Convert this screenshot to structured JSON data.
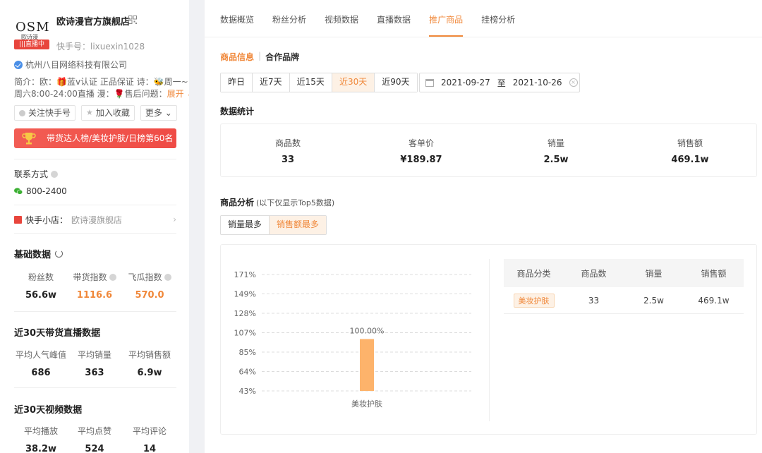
{
  "shop": {
    "logo_text": "OSM",
    "logo_sub": "欧诗漫",
    "live_badge": "|||直播中",
    "title": "欧诗漫官方旗舰店",
    "kuaishou_id": "快手号：lixuexin1028",
    "company": "杭州八目网络科技有限公司",
    "intro_line1": "简介：欧：🎁蓝v认证 正品保证 诗：🐝周一~",
    "intro_line2": "周六8:00-24:00直播 漫：🌹售后问题：",
    "expand": "展开 ⌄",
    "btn_follow": "关注快手号",
    "btn_collect": "加入收藏",
    "btn_more": "更多 ⌄",
    "rank_banner": "带货达人榜/美妆护肤/日榜第60名"
  },
  "contact": {
    "label": "联系方式",
    "phone": "800-2400"
  },
  "store": {
    "label": "快手小店：",
    "name": "欧诗漫旗舰店"
  },
  "basic": {
    "title": "基础数据",
    "items": [
      {
        "label": "粉丝数",
        "value": "56.6w"
      },
      {
        "label": "带货指数",
        "value": "1116.6"
      },
      {
        "label": "飞瓜指数",
        "value": "570.0"
      }
    ]
  },
  "live30": {
    "title": "近30天带货直播数据",
    "items": [
      {
        "label": "平均人气峰值",
        "value": "686"
      },
      {
        "label": "平均销量",
        "value": "363"
      },
      {
        "label": "平均销售额",
        "value": "6.9w"
      }
    ]
  },
  "video30": {
    "title": "近30天视频数据",
    "items": [
      {
        "label": "平均播放",
        "value": "38.2w"
      },
      {
        "label": "平均点赞",
        "value": "524"
      },
      {
        "label": "平均评论",
        "value": "14"
      }
    ]
  },
  "tabs": [
    "数据概览",
    "粉丝分析",
    "视频数据",
    "直播数据",
    "推广商品",
    "挂榜分析"
  ],
  "subtabs": [
    "商品信息",
    "合作品牌"
  ],
  "ranges": [
    "昨日",
    "近7天",
    "近15天",
    "近30天",
    "近90天"
  ],
  "date": {
    "start": "2021-09-27",
    "sep": "至",
    "end": "2021-10-26"
  },
  "stats": {
    "title": "数据统计",
    "items": [
      {
        "label": "商品数",
        "value": "33"
      },
      {
        "label": "客单价",
        "value": "¥189.87"
      },
      {
        "label": "销量",
        "value": "2.5w"
      },
      {
        "label": "销售额",
        "value": "469.1w"
      }
    ]
  },
  "analysis": {
    "title": "商品分析",
    "note": "(以下仅显示Top5数据)",
    "buttons": [
      "销量最多",
      "销售额最多"
    ],
    "table_headers": [
      "商品分类",
      "商品数",
      "销量",
      "销售额"
    ],
    "rows": [
      {
        "category": "美妆护肤",
        "count": "33",
        "sales": "2.5w",
        "revenue": "469.1w"
      }
    ]
  },
  "chart_data": {
    "type": "bar",
    "y_ticks": [
      "171%",
      "149%",
      "128%",
      "107%",
      "85%",
      "64%",
      "43%"
    ],
    "ylim": [
      43,
      171
    ],
    "categories": [
      "美妆护肤"
    ],
    "values": [
      100
    ],
    "data_labels": [
      "100.00%"
    ],
    "bar_color": "#fdb36b",
    "grid": true
  },
  "colors": {
    "accent": "#f0883a",
    "banner": "#ef4b45"
  }
}
